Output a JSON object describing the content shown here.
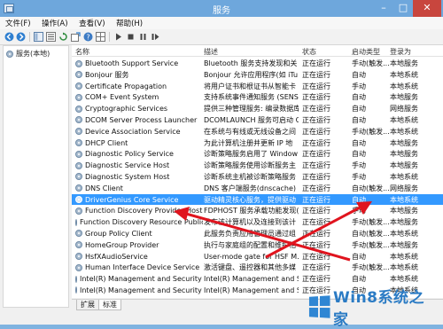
{
  "window": {
    "title": "服务"
  },
  "menu": [
    "文件(F)",
    "操作(A)",
    "查看(V)",
    "帮助(H)"
  ],
  "toolbar": {
    "icons": [
      "back-icon",
      "forward-icon",
      "console-tree-icon",
      "properties-icon",
      "refresh-icon",
      "export-icon",
      "help-icon",
      "grid-icon",
      "play-icon",
      "stop-icon",
      "pause-icon",
      "restart-icon"
    ]
  },
  "tree": {
    "item": "服务(本地)"
  },
  "columns": {
    "name": "名称",
    "desc": "描述",
    "status": "状态",
    "startup": "启动类型",
    "logon": "登录为"
  },
  "rows": [
    {
      "name": "Bluetooth Support Service",
      "desc": "Bluetooth 服务支持发现和关",
      "status": "正在运行",
      "startup": "手动(触发...",
      "logon": "本地服务"
    },
    {
      "name": "Bonjour 服务",
      "desc": "Bonjour 允许应用程序(如 iTu",
      "status": "正在运行",
      "startup": "自动",
      "logon": "本地系统"
    },
    {
      "name": "Certificate Propagation",
      "desc": "将用户证书和根证书从智能卡",
      "status": "正在运行",
      "startup": "手动",
      "logon": "本地系统"
    },
    {
      "name": "COM+ Event System",
      "desc": "支持系统事件通知服务 (SENS)",
      "status": "正在运行",
      "startup": "自动",
      "logon": "本地服务"
    },
    {
      "name": "Cryptographic Services",
      "desc": "提供三种管理服务: 编录数据库",
      "status": "正在运行",
      "startup": "自动",
      "logon": "网络服务"
    },
    {
      "name": "DCOM Server Process Launcher",
      "desc": "DCOMLAUNCH 服务可启动 C",
      "status": "正在运行",
      "startup": "自动",
      "logon": "本地系统"
    },
    {
      "name": "Device Association Service",
      "desc": "在系统与有线或无线设备之间",
      "status": "正在运行",
      "startup": "手动(触发...",
      "logon": "本地系统"
    },
    {
      "name": "DHCP Client",
      "desc": "为此计算机注册并更新 IP 地",
      "status": "正在运行",
      "startup": "自动",
      "logon": "本地服务"
    },
    {
      "name": "Diagnostic Policy Service",
      "desc": "诊断策略服务启用了 Window",
      "status": "正在运行",
      "startup": "自动",
      "logon": "本地服务"
    },
    {
      "name": "Diagnostic Service Host",
      "desc": "诊断策略服务使用诊断服务主",
      "status": "正在运行",
      "startup": "手动",
      "logon": "本地服务"
    },
    {
      "name": "Diagnostic System Host",
      "desc": "诊断系统主机被诊断策略服务",
      "status": "正在运行",
      "startup": "手动",
      "logon": "本地系统"
    },
    {
      "name": "DNS Client",
      "desc": "DNS 客户端服务(dnscache)",
      "status": "正在运行",
      "startup": "自动(触发...",
      "logon": "网络服务"
    },
    {
      "name": "DriverGenius Core Service",
      "desc": "驱动精灵核心服务，提供驱动",
      "status": "正在运行",
      "startup": "自动",
      "logon": "本地系统"
    },
    {
      "name": "Function Discovery Provider Host",
      "desc": "FDPHOST 服务承载功能发现(",
      "status": "正在运行",
      "startup": "手动",
      "logon": "本地服务"
    },
    {
      "name": "Function Discovery Resource Public...",
      "desc": "发布该计算机以及连接到该计",
      "status": "正在运行",
      "startup": "手动(触发...",
      "logon": "本地服务"
    },
    {
      "name": "Group Policy Client",
      "desc": "此服务负责应用管理员通过组",
      "status": "正在运行",
      "startup": "自动(触发...",
      "logon": "本地系统"
    },
    {
      "name": "HomeGroup Provider",
      "desc": "执行与家庭组的配置和维护相",
      "status": "正在运行",
      "startup": "手动(触发...",
      "logon": "本地服务"
    },
    {
      "name": "HsfXAudioService",
      "desc": "User-mode gate for HSF M...",
      "status": "正在运行",
      "startup": "自动",
      "logon": "本地系统"
    },
    {
      "name": "Human Interface Device Service",
      "desc": "激活键盘、遥控器和其他多媒",
      "status": "正在运行",
      "startup": "手动(触发...",
      "logon": "本地系统"
    },
    {
      "name": "Intel(R) Management and Security ...",
      "desc": "Intel(R) Management and S...",
      "status": "正在运行",
      "startup": "自动",
      "logon": "本地系统"
    },
    {
      "name": "Intel(R) Management and Security ...",
      "desc": "Intel(R) Management and S...",
      "status": "正在运行",
      "startup": "自动",
      "logon": "本地系统"
    }
  ],
  "tabs": [
    "扩展",
    "标准"
  ],
  "watermark": {
    "text": "Win8系统之家"
  },
  "colors": {
    "titlebar": "#6ea7dc",
    "selection": "#3399ff",
    "arrow": "#e0141e",
    "watermark": "#2b7bc4"
  }
}
